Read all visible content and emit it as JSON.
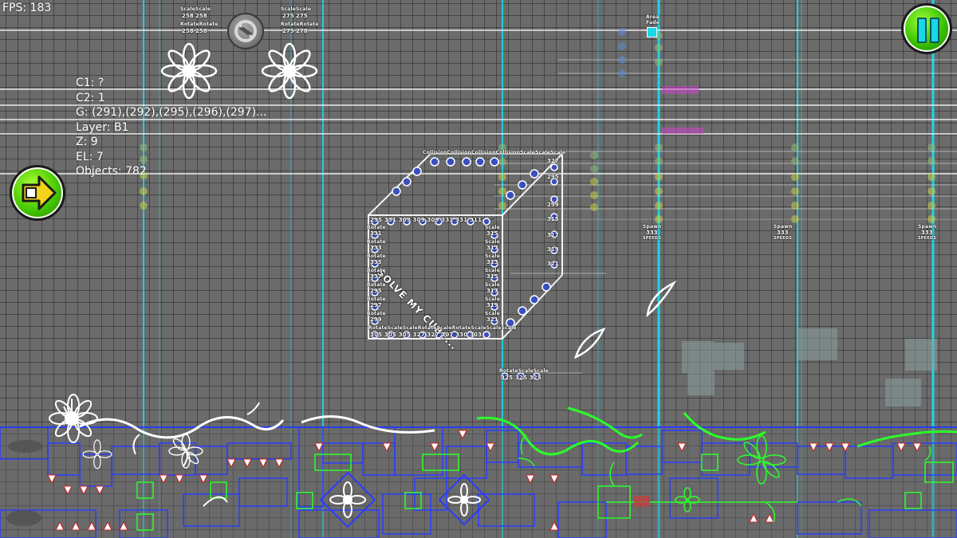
{
  "hud": {
    "fps": "FPS: 183",
    "debug_lines": [
      "C1: ?",
      "C2: 1",
      "G: (291),(292),(295),(296),(297)...",
      "Layer: B1",
      "Z: 9",
      "EL: 7",
      "Objects: 782"
    ]
  },
  "buttons": {
    "pause": {
      "icon": "pause-icon"
    },
    "playtest": {
      "icon": "play-arrow-icon"
    },
    "top_center": {
      "icon": "rotate-trigger-icon"
    }
  },
  "editor": {
    "cube_caption": "SOLVE MY CUBE...",
    "top_left_trigger": {
      "row1": "ScaleScale",
      "row2": "258 258",
      "row3": "RotateRotate",
      "row4": "258 258"
    },
    "top_right_trigger": {
      "row1": "ScaleScale",
      "row2": "275 275",
      "row3": "RotateRotate",
      "row4": "275 278"
    },
    "cube_top_row": "CollisionCollisionCollisionCollisionScaleScaleScale",
    "cube_top_labels": "CollisionCollisionCollisionCollisionScaleScaleScale",
    "cube_bottom_row": "RotateScaleScaleRotateScaleRotateScaleScaleScale",
    "cube_bottom_numbers": "305 305 305 327 327 307 330 303",
    "cube_mid_row": "295 331 309 309 309 331 331 311",
    "cube_left_labels": [
      "Rotate",
      "Rotate",
      "Rotate",
      "Rotate",
      "Rotate",
      "Rotate",
      "Rotate",
      "Rotate"
    ],
    "cube_left_numbers": [
      "331",
      "333",
      "335",
      "337",
      "295",
      "297",
      "299"
    ],
    "cube_right_labels": [
      "Scale",
      "Scale",
      "Scale",
      "Scale",
      "Scale",
      "Scale",
      "Scale"
    ],
    "cube_right_numbers": [
      "315",
      "317",
      "313",
      "315",
      "317",
      "319",
      "321"
    ],
    "cube_far_right_numbers": [
      "327",
      "295",
      "299",
      "315",
      "317",
      "319",
      "321",
      "323"
    ],
    "lower_trigger": {
      "row1": "RotateScaleScale",
      "row2": "325 325 325"
    },
    "area_fade": {
      "line1": "Area",
      "line2": "Fade"
    },
    "spawn_labels": [
      {
        "label": "Spawn",
        "group": "333",
        "delay": "SPEEDS"
      },
      {
        "label": "Spawn",
        "group": "333",
        "delay": "SPEEDS"
      },
      {
        "label": "Spawn",
        "group": "333",
        "delay": "SPEEDS"
      }
    ]
  },
  "colors": {
    "background": "#6b6b6b",
    "guide_line": "#19d6e8",
    "block_outline": "#2a3cff",
    "deco_green": "#2bff2b",
    "button_green": "#38c000",
    "pause_cyan": "#19d6e8"
  }
}
